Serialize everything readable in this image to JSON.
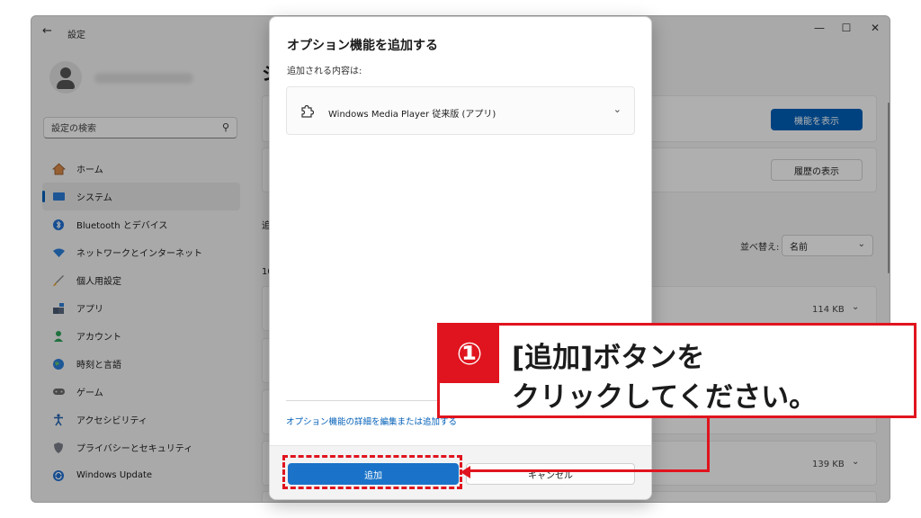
{
  "window": {
    "app_title": "設定",
    "controls": {
      "minimize": "—",
      "maximize": "☐",
      "close": "✕"
    }
  },
  "sidebar": {
    "search_placeholder": "設定の検索",
    "items": [
      {
        "label": "ホーム",
        "icon": "home-icon"
      },
      {
        "label": "システム",
        "icon": "system-icon",
        "active": true
      },
      {
        "label": "Bluetooth とデバイス",
        "icon": "bluetooth-icon"
      },
      {
        "label": "ネットワークとインターネット",
        "icon": "network-icon"
      },
      {
        "label": "個人用設定",
        "icon": "brush-icon"
      },
      {
        "label": "アプリ",
        "icon": "apps-icon"
      },
      {
        "label": "アカウント",
        "icon": "account-icon"
      },
      {
        "label": "時刻と言語",
        "icon": "globe-icon"
      },
      {
        "label": "ゲーム",
        "icon": "gamepad-icon"
      },
      {
        "label": "アクセシビリティ",
        "icon": "accessibility-icon"
      },
      {
        "label": "プライバシーとセキュリティ",
        "icon": "shield-icon"
      },
      {
        "label": "Windows Update",
        "icon": "update-icon"
      }
    ]
  },
  "main": {
    "title_fragment": "シ",
    "view_features_button": "機能を表示",
    "history_button": "履歴の表示",
    "section_fragment": "追",
    "count_fragment": "10",
    "sort_label": "並べ替え:",
    "sort_value": "名前",
    "sizes": [
      "114 KB",
      "139 KB"
    ]
  },
  "dialog": {
    "title": "オプション機能を追加する",
    "subtitle": "追加される内容は:",
    "feature_name": "Windows Media Player 従来版 (アプリ)",
    "link": "オプション機能の詳細を編集または追加する",
    "add_button": "追加",
    "cancel_button": "キャンセル"
  },
  "annotation": {
    "step_number": "①",
    "line1": "[追加]ボタンを",
    "line2": "クリックしてください。"
  },
  "colors": {
    "accent": "#005fb8",
    "annotation_red": "#e0141e"
  }
}
